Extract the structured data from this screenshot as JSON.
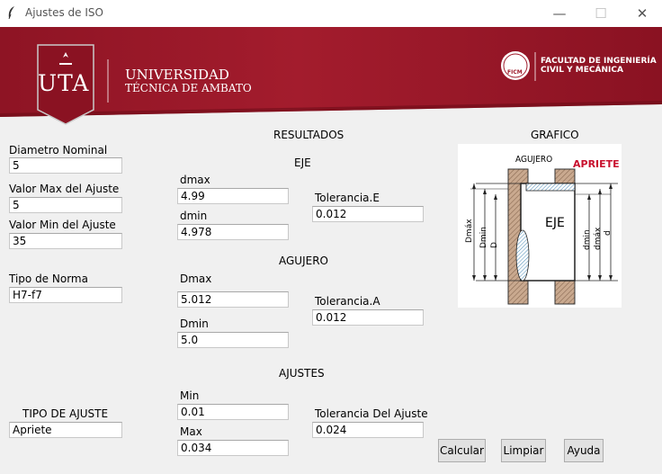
{
  "window": {
    "title": "Ajustes de ISO",
    "minimize": "—",
    "maximize": "☐",
    "close": "✕"
  },
  "banner": {
    "logo_left": "UTA",
    "univ_line1": "UNIVERSIDAD",
    "univ_line2": "TÉCNICA DE AMBATO",
    "seal_text": "FICM",
    "faculty_line1": "FACULTAD DE INGENIERÍA",
    "faculty_line2": "CIVIL Y MECÁNICA",
    "colors": {
      "primary": "#9e1a2a",
      "dark": "#7a0f1e"
    }
  },
  "inputs": {
    "diametro_label": "Diametro Nominal",
    "diametro_value": "5",
    "max_label": "Valor Max del Ajuste",
    "max_value": "5",
    "min_label": "Valor Min del Ajuste",
    "min_value": "35",
    "norma_label": "Tipo de Norma",
    "norma_value": "H7-f7",
    "tipo_label": "TIPO DE AJUSTE",
    "tipo_value": "Apriete"
  },
  "results": {
    "header": "RESULTADOS",
    "eje_header": "EJE",
    "dmax_label": "dmax",
    "dmax_value": "4.99",
    "dmin_label": "dmin",
    "dmin_value": "4.978",
    "tol_e_label": "Tolerancia.E",
    "tol_e_value": "0.012",
    "agujero_header": "AGUJERO",
    "Dmax_label": "Dmax",
    "Dmax_value": "5.012",
    "Dmin_label": "Dmin",
    "Dmin_value": "5.0",
    "tol_a_label": "Tolerancia.A",
    "tol_a_value": "0.012",
    "ajustes_header": "AJUSTES",
    "min_label": "Min",
    "min_value": "0.01",
    "max_label": "Max",
    "max_value": "0.034",
    "tol_ajuste_label": "Tolerancia Del Ajuste",
    "tol_ajuste_value": "0.024"
  },
  "graph": {
    "header": "GRAFICO",
    "agujero": "AGUJERO",
    "apriete": "APRIETE",
    "eje": "EJE",
    "dim_Dmax": "Dmáx",
    "dim_Dmin": "Dmin",
    "dim_D": "D",
    "dim_dmin": "dmin",
    "dim_dmax": "dmáx",
    "dim_d": "d"
  },
  "buttons": {
    "calcular": "Calcular",
    "limpiar": "Limpiar",
    "ayuda": "Ayuda"
  }
}
